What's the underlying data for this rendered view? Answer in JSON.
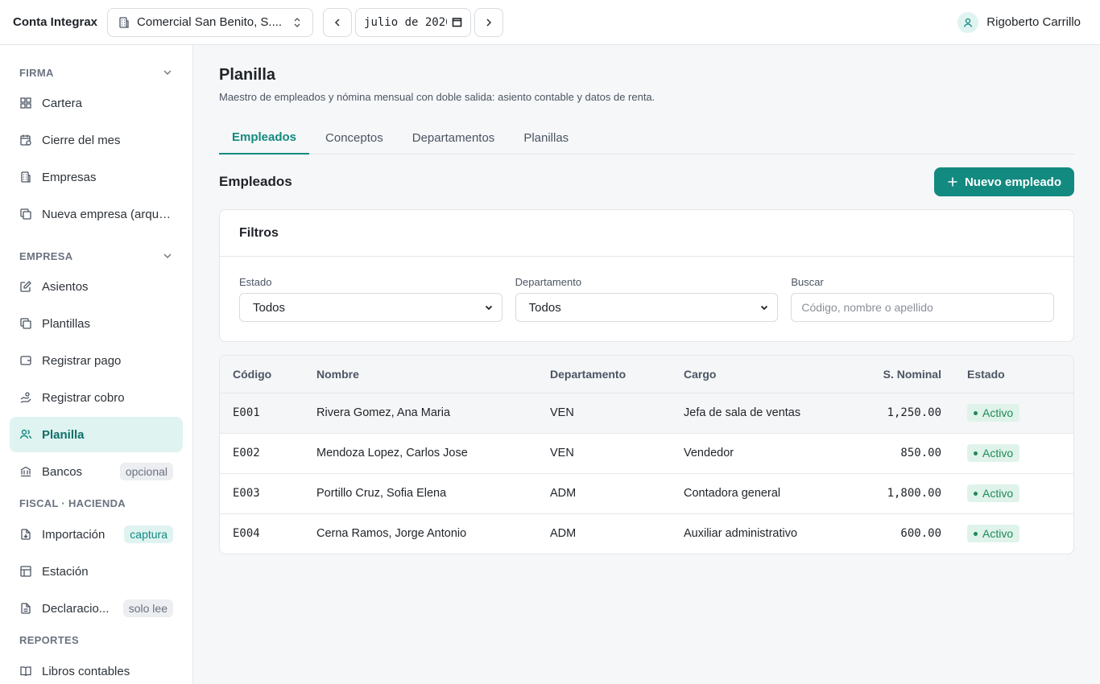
{
  "app": {
    "title": "Conta Integrax"
  },
  "topbar": {
    "company": "Comercial San Benito, S....",
    "period": "julio de 2026",
    "user_name": "Rigoberto Carrillo"
  },
  "sidebar": {
    "sections": [
      {
        "title": "FIRMA",
        "items": [
          {
            "label": "Cartera",
            "icon": "grid-icon"
          },
          {
            "label": "Cierre del mes",
            "icon": "calendar-clock-icon"
          },
          {
            "label": "Empresas",
            "icon": "building-icon"
          },
          {
            "label": "Nueva empresa (arque...",
            "icon": "copy-icon"
          }
        ]
      },
      {
        "title": "EMPRESA",
        "items": [
          {
            "label": "Asientos",
            "icon": "edit-icon"
          },
          {
            "label": "Plantillas",
            "icon": "copy-icon"
          },
          {
            "label": "Registrar pago",
            "icon": "wallet-icon"
          },
          {
            "label": "Registrar cobro",
            "icon": "hand-coins-icon"
          },
          {
            "label": "Planilla",
            "icon": "users-icon"
          },
          {
            "label": "Bancos",
            "icon": "bank-icon",
            "badge": "opcional"
          }
        ]
      },
      {
        "title": "FISCAL · HACIENDA",
        "items": [
          {
            "label": "Importación",
            "icon": "file-import-icon",
            "badge": "captura"
          },
          {
            "label": "Estación",
            "icon": "table-icon"
          },
          {
            "label": "Declaracio...",
            "icon": "file-text-icon",
            "badge": "solo lee"
          }
        ]
      },
      {
        "title": "REPORTES",
        "items": [
          {
            "label": "Libros contables",
            "icon": "book-icon"
          }
        ]
      }
    ]
  },
  "page": {
    "title": "Planilla",
    "subtitle": "Maestro de empleados y nómina mensual con doble salida: asiento contable y datos de renta.",
    "tabs": [
      "Empleados",
      "Conceptos",
      "Departamentos",
      "Planillas"
    ],
    "section_title": "Empleados",
    "new_button": "Nuevo empleado"
  },
  "filters": {
    "title": "Filtros",
    "estado_label": "Estado",
    "estado_value": "Todos",
    "depto_label": "Departamento",
    "depto_value": "Todos",
    "buscar_label": "Buscar",
    "buscar_placeholder": "Código, nombre o apellido"
  },
  "table": {
    "headers": [
      "Código",
      "Nombre",
      "Departamento",
      "Cargo",
      "S. Nominal",
      "Estado"
    ],
    "rows": [
      {
        "codigo": "E001",
        "nombre": "Rivera Gomez, Ana Maria",
        "depto": "VEN",
        "cargo": "Jefa de sala de ventas",
        "salario": "1,250.00",
        "estado": "Activo"
      },
      {
        "codigo": "E002",
        "nombre": "Mendoza Lopez, Carlos Jose",
        "depto": "VEN",
        "cargo": "Vendedor",
        "salario": "850.00",
        "estado": "Activo"
      },
      {
        "codigo": "E003",
        "nombre": "Portillo Cruz, Sofia Elena",
        "depto": "ADM",
        "cargo": "Contadora general",
        "salario": "1,800.00",
        "estado": "Activo"
      },
      {
        "codigo": "E004",
        "nombre": "Cerna Ramos, Jorge Antonio",
        "depto": "ADM",
        "cargo": "Auxiliar administrativo",
        "salario": "600.00",
        "estado": "Activo"
      }
    ]
  },
  "colors": {
    "accent": "#138a80",
    "active_bg": "#dff3f1",
    "status_bg": "#dff3ea",
    "status_fg": "#1e8a55"
  }
}
